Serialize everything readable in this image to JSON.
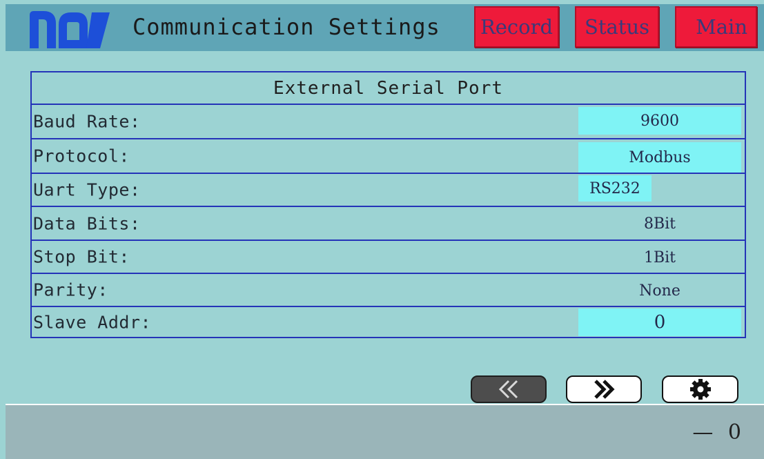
{
  "header": {
    "title": "Communication Settings",
    "logo_name": "noa-logo",
    "buttons": {
      "record": "Record",
      "status": "Status",
      "main": "Main"
    }
  },
  "panel": {
    "heading": "External Serial Port",
    "rows": [
      {
        "label": "Baud Rate:",
        "value": "9600"
      },
      {
        "label": "Protocol:",
        "value": "Modbus"
      },
      {
        "label": "Uart Type:",
        "value": "RS232"
      },
      {
        "label": "Data Bits:",
        "value": "8Bit"
      },
      {
        "label": "Stop Bit:",
        "value": "1Bit"
      },
      {
        "label": "Parity:",
        "value": "None"
      },
      {
        "label": "Slave Addr:",
        "value": "0"
      }
    ]
  },
  "nav": {
    "prev_icon": "double-chevron-left-icon",
    "next_icon": "double-chevron-right-icon",
    "settings_icon": "gear-icon"
  },
  "footer": {
    "value": "— 0"
  },
  "colors": {
    "background": "#9cd3d3",
    "header": "#5fa5b6",
    "nav_button": "#ee1a3a",
    "field": "#7ff3f5",
    "grid_line": "#2433b8",
    "footer": "#9ab5b9"
  }
}
